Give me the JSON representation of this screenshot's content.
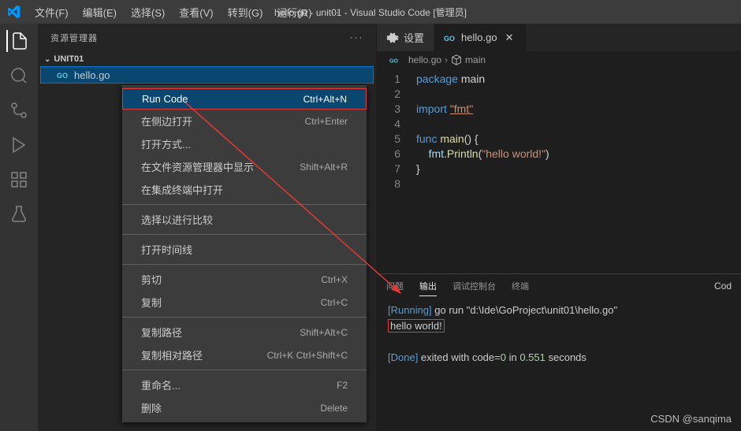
{
  "titlebar": {
    "title": "hello.go - unit01 - Visual Studio Code [管理员]"
  },
  "menubar": {
    "items": [
      "文件(F)",
      "编辑(E)",
      "选择(S)",
      "查看(V)",
      "转到(G)",
      "运行(R)"
    ],
    "more": "···"
  },
  "sidebar": {
    "title": "资源管理器",
    "more": "···",
    "section": "UNIT01",
    "file": "hello.go"
  },
  "tabs": {
    "settings": "设置",
    "file": "hello.go"
  },
  "breadcrumb": {
    "file": "hello.go",
    "symbol": "main"
  },
  "code": {
    "lines": [
      {
        "n": "1",
        "html": "<span class='kw'>package</span> <span class='pkg'>main</span>"
      },
      {
        "n": "2",
        "html": ""
      },
      {
        "n": "3",
        "html": "<span class='kw'>import</span> <span class='str-u'>\"fmt\"</span>"
      },
      {
        "n": "4",
        "html": ""
      },
      {
        "n": "5",
        "html": "<span class='kw'>func</span> <span class='fn'>main</span><span class='punc'>() {</span>"
      },
      {
        "n": "6",
        "html": "    <span class='name'>fmt</span><span class='punc'>.</span><span class='fn'>Println</span><span class='punc'>(</span><span class='str'>\"hello world!\"</span><span class='punc'>)</span>"
      },
      {
        "n": "7",
        "html": "<span class='punc'>}</span>"
      },
      {
        "n": "8",
        "html": ""
      }
    ]
  },
  "panel": {
    "tabs": [
      "问题",
      "输出",
      "调试控制台",
      "终端"
    ],
    "activeIndex": 1,
    "codeBtn": "Cod",
    "output": {
      "running_label": "[Running]",
      "running_cmd": " go run \"d:\\Ide\\GoProject\\unit01\\hello.go\"",
      "result": "hello world!",
      "done_label": "[Done]",
      "done_text1": " exited with code=",
      "done_code": "0",
      "done_text2": " in ",
      "done_time": "0.551",
      "done_text3": " seconds"
    }
  },
  "context_menu": {
    "items": [
      {
        "label": "Run Code",
        "shortcut": "Ctrl+Alt+N",
        "highlighted": true
      },
      {
        "label": "在侧边打开",
        "shortcut": "Ctrl+Enter"
      },
      {
        "label": "打开方式...",
        "shortcut": ""
      },
      {
        "label": "在文件资源管理器中显示",
        "shortcut": "Shift+Alt+R"
      },
      {
        "label": "在集成终端中打开",
        "shortcut": ""
      },
      {
        "sep": true
      },
      {
        "label": "选择以进行比较",
        "shortcut": ""
      },
      {
        "sep": true
      },
      {
        "label": "打开时间线",
        "shortcut": ""
      },
      {
        "sep": true
      },
      {
        "label": "剪切",
        "shortcut": "Ctrl+X"
      },
      {
        "label": "复制",
        "shortcut": "Ctrl+C"
      },
      {
        "sep": true
      },
      {
        "label": "复制路径",
        "shortcut": "Shift+Alt+C"
      },
      {
        "label": "复制相对路径",
        "shortcut": "Ctrl+K Ctrl+Shift+C"
      },
      {
        "sep": true
      },
      {
        "label": "重命名...",
        "shortcut": "F2"
      },
      {
        "label": "删除",
        "shortcut": "Delete"
      }
    ]
  },
  "watermark": "CSDN @sanqima"
}
